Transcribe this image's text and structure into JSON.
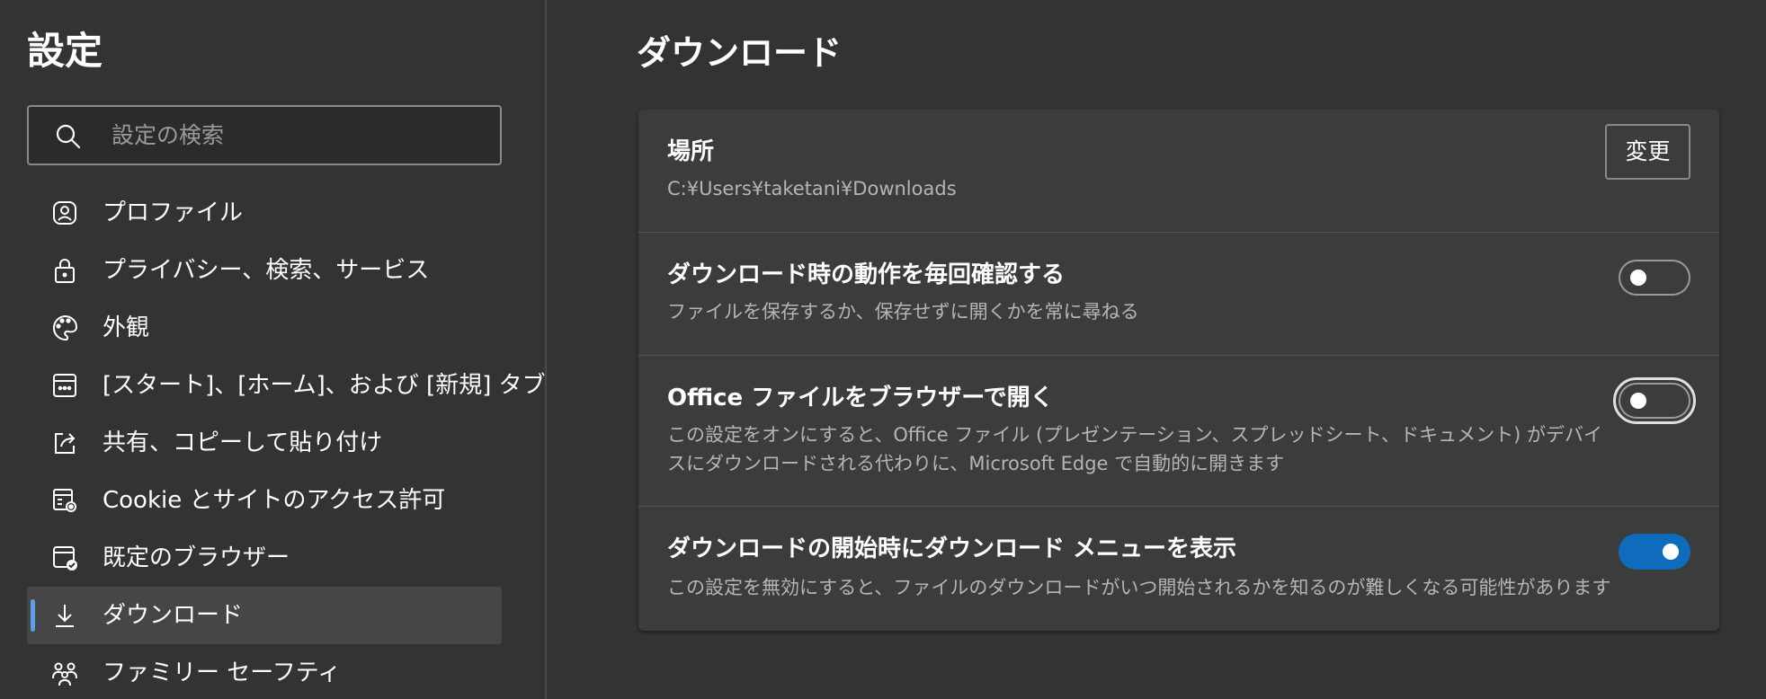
{
  "sidebar": {
    "title": "設定",
    "search": {
      "placeholder": "設定の検索"
    },
    "items": [
      {
        "label": "プロファイル",
        "icon": "profile-icon"
      },
      {
        "label": "プライバシー、検索、サービス",
        "icon": "lock-icon"
      },
      {
        "label": "外観",
        "icon": "palette-icon"
      },
      {
        "label": "[スタート]、[ホーム]、および [新規] タブ",
        "icon": "new-tab-icon"
      },
      {
        "label": "共有、コピーして貼り付け",
        "icon": "share-icon"
      },
      {
        "label": "Cookie とサイトのアクセス許可",
        "icon": "site-permissions-icon"
      },
      {
        "label": "既定のブラウザー",
        "icon": "default-browser-icon"
      },
      {
        "label": "ダウンロード",
        "icon": "download-icon",
        "active": true
      },
      {
        "label": "ファミリー セーフティ",
        "icon": "family-icon"
      }
    ]
  },
  "main": {
    "title": "ダウンロード",
    "location": {
      "title": "場所",
      "path": "C:¥Users¥taketani¥Downloads",
      "change_label": "変更"
    },
    "settings": [
      {
        "title": "ダウンロード時の動作を毎回確認する",
        "desc": "ファイルを保存するか、保存せずに開くかを常に尋ねる",
        "enabled": false
      },
      {
        "title": "Office ファイルをブラウザーで開く",
        "desc": "この設定をオンにすると、Office ファイル (プレゼンテーション、スプレッドシート、ドキュメント) がデバイスにダウンロードされる代わりに、Microsoft Edge で自動的に開きます",
        "enabled": false
      },
      {
        "title": "ダウンロードの開始時にダウンロード メニューを表示",
        "desc": "この設定を無効にすると、ファイルのダウンロードがいつ開始されるかを知るのが難しくなる可能性があります",
        "enabled": true
      }
    ]
  },
  "colors": {
    "background": "#333333",
    "card": "#3c3c3c",
    "accent": "#0f6cbd",
    "active_indicator": "#5aa0e6"
  }
}
